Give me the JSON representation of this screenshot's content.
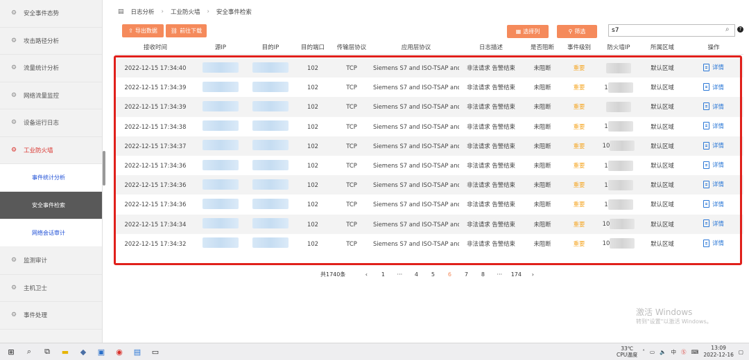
{
  "sidebar": {
    "items": [
      {
        "label": "安全事件态势",
        "icon": "shield-icon"
      },
      {
        "label": "攻击路径分析",
        "icon": "route-icon"
      },
      {
        "label": "流量统计分析",
        "icon": "chart-icon"
      },
      {
        "label": "网络流量监控",
        "icon": "monitor-icon"
      },
      {
        "label": "设备运行日志",
        "icon": "log-icon"
      },
      {
        "label": "工业防火墙",
        "icon": "firewall-icon",
        "active": true
      }
    ],
    "sub_items": [
      {
        "label": "事件统计分析"
      },
      {
        "label": "安全事件检索",
        "active": true
      },
      {
        "label": "网络会话审计"
      }
    ],
    "items_after": [
      {
        "label": "监测审计",
        "icon": "audit-icon"
      },
      {
        "label": "主机卫士",
        "icon": "host-icon"
      },
      {
        "label": "事件处理",
        "icon": "handle-icon"
      }
    ]
  },
  "breadcrumb": [
    "日志分析",
    "工业防火墙",
    "安全事件检索"
  ],
  "toolbar": {
    "export_label": "导出数据",
    "download_label": "前往下载",
    "columns_label": "选择列",
    "filter_label": "筛选",
    "search_value": "s7"
  },
  "table": {
    "headers": [
      "接收时间",
      "源IP",
      "目的IP",
      "目的端口",
      "传输层协议",
      "应用层协议",
      "日志描述",
      "是否阻断",
      "事件级别",
      "防火墙IP",
      "所属区域",
      "操作"
    ],
    "rows": [
      {
        "time": "2022-12-15 17:34:40",
        "port": "102",
        "transport": "TCP",
        "app": "Siemens S7 and ISO-TSAP and MMS",
        "desc": "非法请求 告警结束",
        "blocked": "未阻断",
        "level": "重要",
        "fw_prefix": "",
        "zone": "默认区域",
        "action": "详情"
      },
      {
        "time": "2022-12-15 17:34:39",
        "port": "102",
        "transport": "TCP",
        "app": "Siemens S7 and ISO-TSAP and MMS",
        "desc": "非法请求 告警结束",
        "blocked": "未阻断",
        "level": "重要",
        "fw_prefix": "1",
        "zone": "默认区域",
        "action": "详情"
      },
      {
        "time": "2022-12-15 17:34:39",
        "port": "102",
        "transport": "TCP",
        "app": "Siemens S7 and ISO-TSAP and MMS",
        "desc": "非法请求 告警结束",
        "blocked": "未阻断",
        "level": "重要",
        "fw_prefix": "",
        "zone": "默认区域",
        "action": "详情"
      },
      {
        "time": "2022-12-15 17:34:38",
        "port": "102",
        "transport": "TCP",
        "app": "Siemens S7 and ISO-TSAP and MMS",
        "desc": "非法请求 告警结束",
        "blocked": "未阻断",
        "level": "重要",
        "fw_prefix": "1",
        "zone": "默认区域",
        "action": "详情"
      },
      {
        "time": "2022-12-15 17:34:37",
        "port": "102",
        "transport": "TCP",
        "app": "Siemens S7 and ISO-TSAP and MMS",
        "desc": "非法请求 告警结束",
        "blocked": "未阻断",
        "level": "重要",
        "fw_prefix": "10",
        "zone": "默认区域",
        "action": "详情"
      },
      {
        "time": "2022-12-15 17:34:36",
        "port": "102",
        "transport": "TCP",
        "app": "Siemens S7 and ISO-TSAP and MMS",
        "desc": "非法请求 告警结束",
        "blocked": "未阻断",
        "level": "重要",
        "fw_prefix": "1",
        "zone": "默认区域",
        "action": "详情"
      },
      {
        "time": "2022-12-15 17:34:36",
        "port": "102",
        "transport": "TCP",
        "app": "Siemens S7 and ISO-TSAP and MMS",
        "desc": "非法请求 告警结束",
        "blocked": "未阻断",
        "level": "重要",
        "fw_prefix": "1",
        "zone": "默认区域",
        "action": "详情"
      },
      {
        "time": "2022-12-15 17:34:36",
        "port": "102",
        "transport": "TCP",
        "app": "Siemens S7 and ISO-TSAP and MMS",
        "desc": "非法请求 告警结束",
        "blocked": "未阻断",
        "level": "重要",
        "fw_prefix": "1",
        "zone": "默认区域",
        "action": "详情"
      },
      {
        "time": "2022-12-15 17:34:34",
        "port": "102",
        "transport": "TCP",
        "app": "Siemens S7 and ISO-TSAP and MMS",
        "desc": "非法请求 告警结束",
        "blocked": "未阻断",
        "level": "重要",
        "fw_prefix": "10",
        "zone": "默认区域",
        "action": "详情"
      },
      {
        "time": "2022-12-15 17:34:32",
        "port": "102",
        "transport": "TCP",
        "app": "Siemens S7 and ISO-TSAP and MMS",
        "desc": "非法请求 告警结束",
        "blocked": "未阻断",
        "level": "重要",
        "fw_prefix": "10",
        "zone": "默认区域",
        "action": "详情"
      }
    ]
  },
  "pagination": {
    "total": "共1740条",
    "prev": "‹",
    "pages": [
      "1",
      "···",
      "4",
      "5",
      "6",
      "7",
      "8",
      "···",
      "174"
    ],
    "current": "6",
    "next": "›"
  },
  "watermark": {
    "title": "激活 Windows",
    "subtitle": "转到\"设置\"以激活 Windows。"
  },
  "taskbar": {
    "temp": "33℃",
    "cpu": "CPU温度",
    "ime": "中",
    "time": "13:09",
    "date": "2022-12-16"
  },
  "colors": {
    "accent": "#f58a5b",
    "active_red": "#d9302a",
    "link_blue": "#2a77d6",
    "level_orange": "#f5a623",
    "highlight": "#e0201b"
  }
}
